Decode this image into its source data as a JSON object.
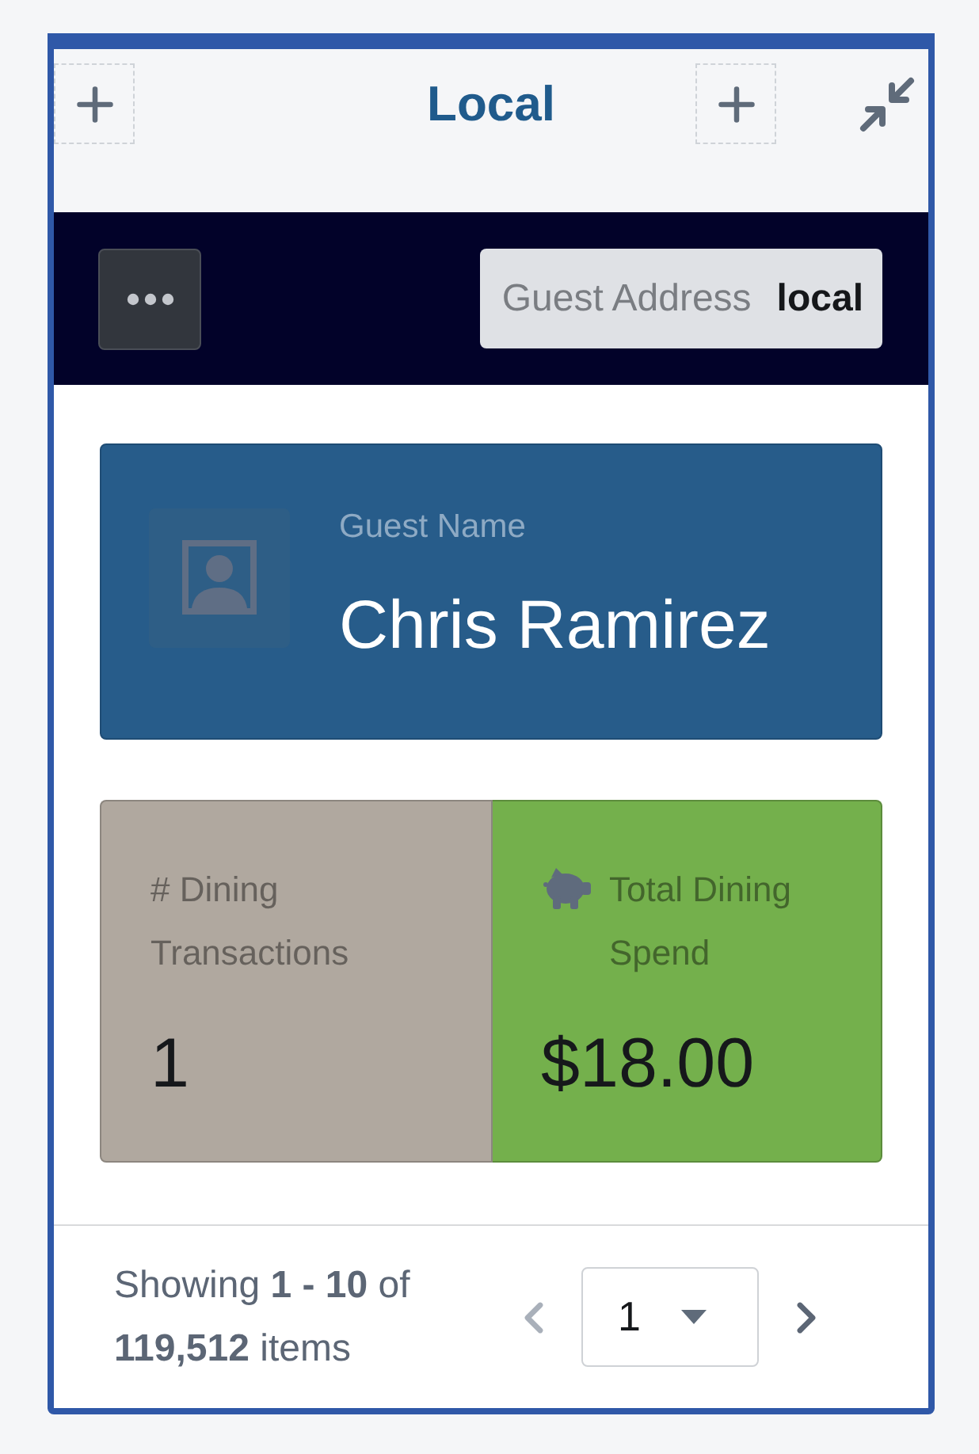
{
  "header": {
    "title": "Local"
  },
  "toolbar": {
    "filter": {
      "label": "Guest Address",
      "value": "local"
    }
  },
  "guest_card": {
    "label": "Guest Name",
    "name": "Chris Ramirez"
  },
  "metrics": [
    {
      "kind": "count",
      "label": "# Dining Transactions",
      "value": "1",
      "color": "#b0a89f"
    },
    {
      "kind": "money",
      "label": "Total Dining Spend",
      "value": "$18.00",
      "color": "#74b04c"
    }
  ],
  "pagination": {
    "summary": "Showing **1 - 10** of **119,512** items",
    "page": "1",
    "previous": {
      "disabled": true
    },
    "next": {
      "disabled": false
    }
  }
}
